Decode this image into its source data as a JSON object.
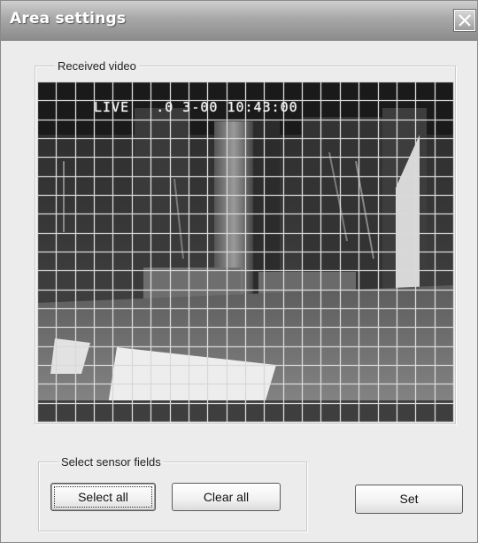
{
  "window": {
    "title": "Area settings",
    "close_icon": "close-icon"
  },
  "video_group": {
    "legend": "Received video",
    "osd_text": "LIVE   .0 3-00 10:43:00",
    "grid": {
      "columns": 22,
      "rows": 18,
      "line_color": "#d9d9d9"
    }
  },
  "sensor_group": {
    "legend": "Select sensor fields",
    "select_all_label": "Select all",
    "clear_all_label": "Clear all"
  },
  "actions": {
    "set_label": "Set"
  },
  "colors": {
    "window_bg": "#ececec",
    "title_bar": "#9a9a9a",
    "video_bg": "#1b1b1b"
  }
}
